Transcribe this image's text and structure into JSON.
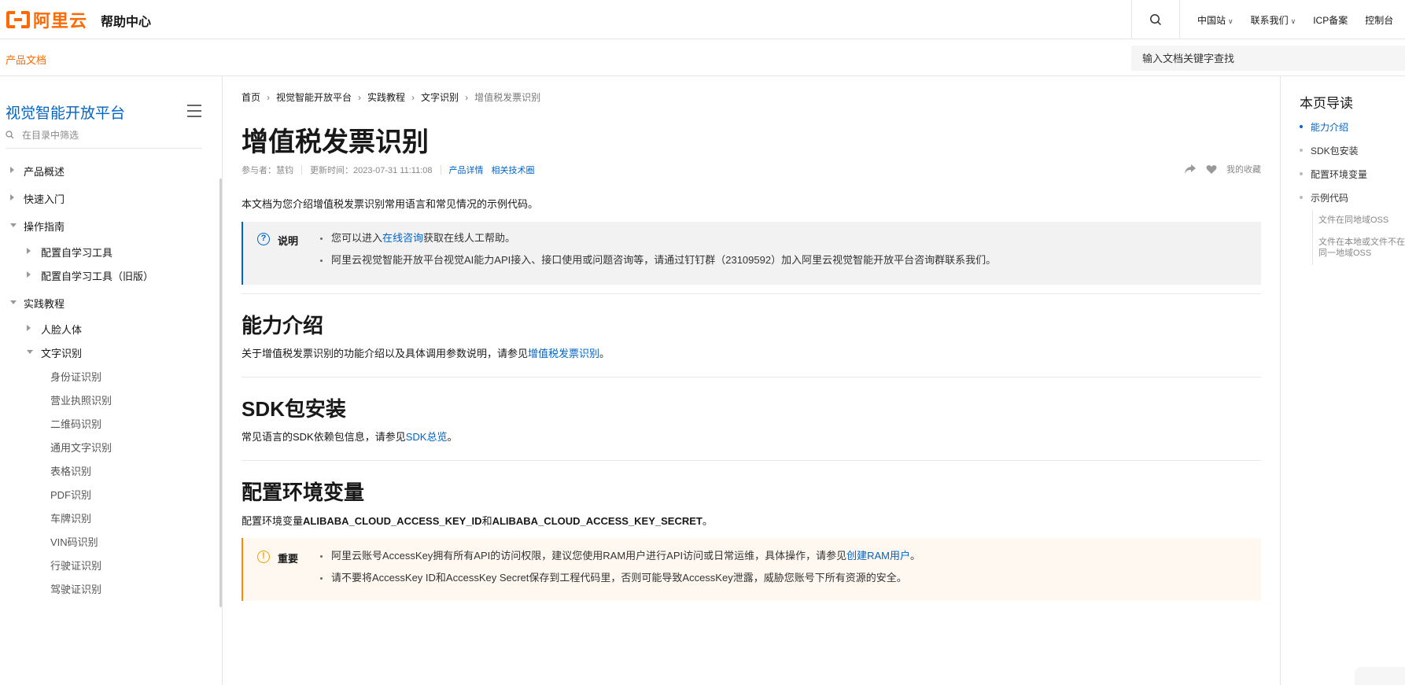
{
  "header": {
    "logo_text": "阿里云",
    "help_center": "帮助中心",
    "links": [
      "中国站",
      "联系我们",
      "ICP备案",
      "控制台"
    ],
    "brand_color": "#ff6a00"
  },
  "subheader": {
    "product_docs": "产品文档",
    "search_placeholder": "输入文档关键字查找"
  },
  "sidebar": {
    "title": "视觉智能开放平台",
    "filter_placeholder": "在目录中筛选",
    "items": [
      {
        "label": "产品概述",
        "level": 1,
        "state": "collapsed"
      },
      {
        "label": "快速入门",
        "level": 1,
        "state": "collapsed"
      },
      {
        "label": "操作指南",
        "level": 1,
        "state": "expanded"
      },
      {
        "label": "配置自学习工具",
        "level": 2,
        "state": "collapsed"
      },
      {
        "label": "配置自学习工具（旧版）",
        "level": 2,
        "state": "collapsed"
      },
      {
        "label": "实践教程",
        "level": 1,
        "state": "expanded"
      },
      {
        "label": "人脸人体",
        "level": 2,
        "state": "collapsed"
      },
      {
        "label": "文字识别",
        "level": 2,
        "state": "expanded"
      },
      {
        "label": "身份证识别",
        "level": 3
      },
      {
        "label": "营业执照识别",
        "level": 3
      },
      {
        "label": "二维码识别",
        "level": 3
      },
      {
        "label": "通用文字识别",
        "level": 3
      },
      {
        "label": "表格识别",
        "level": 3
      },
      {
        "label": "PDF识别",
        "level": 3
      },
      {
        "label": "车牌识别",
        "level": 3
      },
      {
        "label": "VIN码识别",
        "level": 3
      },
      {
        "label": "行驶证识别",
        "level": 3
      },
      {
        "label": "驾驶证识别",
        "level": 3
      }
    ]
  },
  "main": {
    "breadcrumb": [
      "首页",
      "视觉智能开放平台",
      "实践教程",
      "文字识别",
      "增值税发票识别"
    ],
    "title": "增值税发票识别",
    "meta": {
      "contributor": "参与者：慧钧",
      "updated": "更新时间：2023-07-31 11:11:08",
      "product_detail": "产品详情",
      "tech_circle": "相关技术圈",
      "favorite": "我的收藏"
    },
    "intro": "本文档为您介绍增值税发票识别常用语言和常见情况的示例代码。",
    "note": {
      "label": "说明",
      "item1_pre": "您可以进入",
      "item1_link": "在线咨询",
      "item1_post": "获取在线人工帮助。",
      "item2": "阿里云视觉智能开放平台视觉AI能力API接入、接口使用或问题咨询等，请通过钉钉群（23109592）加入阿里云视觉智能开放平台咨询群联系我们。"
    },
    "sections": {
      "ability": {
        "heading": "能力介绍",
        "text_pre": "关于增值税发票识别的功能介绍以及具体调用参数说明，请参见",
        "link": "增值税发票识别",
        "text_post": "。"
      },
      "sdk": {
        "heading": "SDK包安装",
        "text_pre": "常见语言的SDK依赖包信息，请参见",
        "link": "SDK总览",
        "text_post": "。"
      },
      "env": {
        "heading": "配置环境变量",
        "text_pre": "配置环境变量",
        "key1": "ALIBABA_CLOUD_ACCESS_KEY_ID",
        "mid": "和",
        "key2": "ALIBABA_CLOUD_ACCESS_KEY_SECRET",
        "text_post": "。"
      }
    },
    "warning": {
      "label": "重要",
      "item1_pre": "阿里云账号AccessKey拥有所有API的访问权限，建议您使用RAM用户进行API访问或日常运维，具体操作，请参见",
      "item1_link": "创建RAM用户",
      "item1_post": "。",
      "item2": "请不要将AccessKey ID和AccessKey Secret保存到工程代码里，否则可能导致AccessKey泄露，威胁您账号下所有资源的安全。"
    }
  },
  "toc": {
    "title": "本页导读",
    "items": [
      "能力介绍",
      "SDK包安装",
      "配置环境变量",
      "示例代码"
    ],
    "active": "能力介绍",
    "sub_items": [
      "文件在同地域OSS",
      "文件在本地或文件不在同一地域OSS"
    ]
  },
  "colors": {
    "link": "#0064c8",
    "accent": "#ff6a00",
    "note_border": "#0064c8",
    "warning_border": "#ff8a00"
  }
}
